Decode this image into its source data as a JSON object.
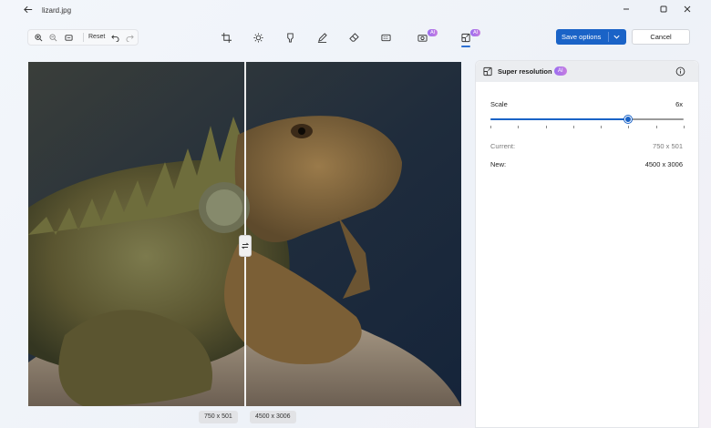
{
  "window": {
    "title": "lizard.jpg"
  },
  "toolbar": {
    "reset_label": "Reset",
    "tools": [
      {
        "name": "crop-icon"
      },
      {
        "name": "adjust-icon"
      },
      {
        "name": "filter-icon"
      },
      {
        "name": "markup-icon"
      },
      {
        "name": "erase-icon"
      },
      {
        "name": "blur-background-icon"
      },
      {
        "name": "background-removal-icon",
        "ai_badge": "AI"
      },
      {
        "name": "super-resolution-icon",
        "ai_badge": "AI",
        "active": true
      }
    ],
    "save_label": "Save options",
    "cancel_label": "Cancel"
  },
  "image": {
    "left_size": "750 x 501",
    "right_size": "4500 x 3006"
  },
  "panel": {
    "title": "Super resolution",
    "badge": "AI",
    "scale_label": "Scale",
    "scale_value": "6x",
    "scale_fraction": 0.71,
    "tick_count": 8,
    "current_label": "Current:",
    "current_value": "750 x 501",
    "new_label": "New:",
    "new_value": "4500 x 3006"
  },
  "colors": {
    "accent": "#1a63c7",
    "ai_badge": "#a874ea",
    "panel_header": "#ebedf0"
  }
}
